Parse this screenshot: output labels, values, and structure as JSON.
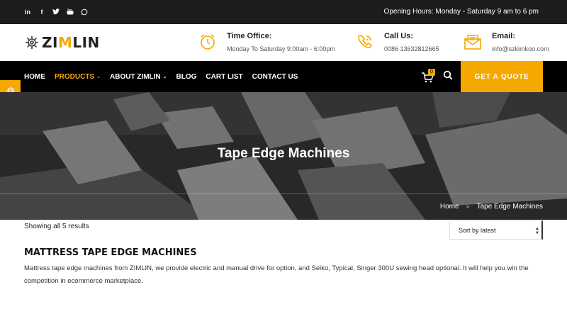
{
  "topbar": {
    "social": [
      "in",
      "f",
      "t",
      "yt",
      "wa"
    ],
    "social_icons": [
      "linkedin-icon",
      "facebook-icon",
      "twitter-icon",
      "youtube-icon",
      "whatsapp-icon"
    ],
    "hours": "Opening Hours: Monday - Saturday 9 am to 6 pm"
  },
  "header": {
    "logo_prefix": "ZI",
    "logo_accent": "M",
    "logo_suffix": "LIN",
    "time_title": "Time Office:",
    "time_text": "Monday To Saturday 9:00am - 6:00pm",
    "call_title": "Call Us:",
    "call_text": "0086 13632812665",
    "email_title": "Email:",
    "email_text": "info@szkimkoo.com"
  },
  "nav": {
    "items": [
      {
        "label": "HOME"
      },
      {
        "label": "PRODUCTS"
      },
      {
        "label": "ABOUT ZIMLIN"
      },
      {
        "label": "BLOG"
      },
      {
        "label": "CART LIST"
      },
      {
        "label": "CONTACT US"
      }
    ],
    "cart_count": "0",
    "quote_label": "GET A QUOTE"
  },
  "hero": {
    "title": "Tape Edge Machines",
    "breadcrumb_home": "Home",
    "breadcrumb_sep": "»",
    "breadcrumb_current": "Tape Edge Machines"
  },
  "content": {
    "results": "Showing all 5 results",
    "sort_value": "Sort by latest",
    "category_title": "MATTRESS TAPE EDGE MACHINES",
    "category_desc": "Mattress tape edge machines from ZIMLIN, we provide electric and manual drive for option, and Seiko, Typical, Singer 300U sewing head optional. It will help you win the competition in ecommerce marketplace."
  },
  "colors": {
    "accent": "#f5a800",
    "topbar": "#1c1c1c",
    "nav": "#000000"
  }
}
